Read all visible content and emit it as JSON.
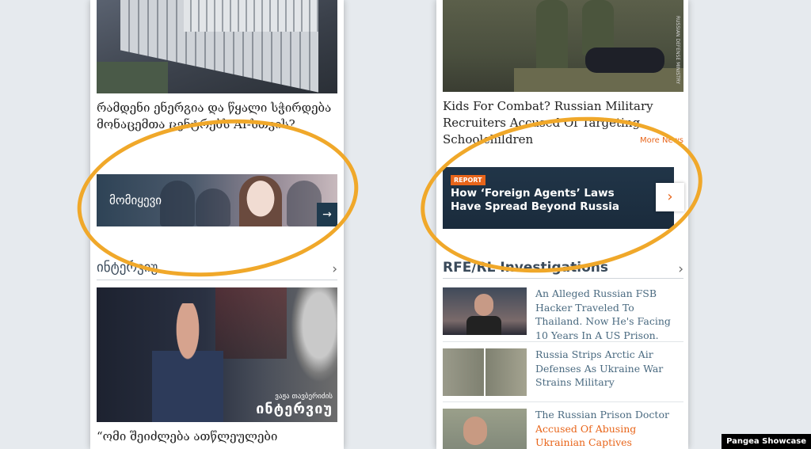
{
  "left": {
    "top_headline": "რამდენი ენერგია და წყალი სჭირდება მონაცემთა ცენტრებს AI-სთვის?",
    "banner": {
      "label": "მომიყევი",
      "arrow": "→"
    },
    "section": {
      "title": "ინტერვიუ",
      "chevron": "›"
    },
    "interview_photo": {
      "caption_small": "ვაჟა თავბერიძის",
      "caption_big": "ინტერვიუ"
    },
    "bottom_headline": "“ომი შეიძლება ათწლეულები"
  },
  "right": {
    "top_headline": "Kids For Combat? Russian Military Recruiters Accused Of Targeting Schoolchildren",
    "photo_credit": "RUSSIAN DEFENSE MINISTRY",
    "more_link": "More News",
    "banner": {
      "tag": "REPORT",
      "title": "How ‘Foreign Agents’ Laws Have Spread Beyond Russia",
      "arrow": "›"
    },
    "section": {
      "title": "RFE/RL Investigations",
      "chevron": "›"
    },
    "items": [
      {
        "text": "An Alleged Russian FSB Hacker Traveled To Thailand. Now He's Facing 10 Years In A US Prison."
      },
      {
        "text": "Russia Strips Arctic Air Defenses As Ukraine War Strains Military"
      },
      {
        "text": "The Russian Prison Doctor",
        "accent": "Accused Of Abusing Ukrainian Captives"
      }
    ]
  },
  "watermark": "Pangea Showcase",
  "colors": {
    "accent": "#e8651a",
    "highlight": "#f0a82a",
    "navy": "#213548"
  }
}
